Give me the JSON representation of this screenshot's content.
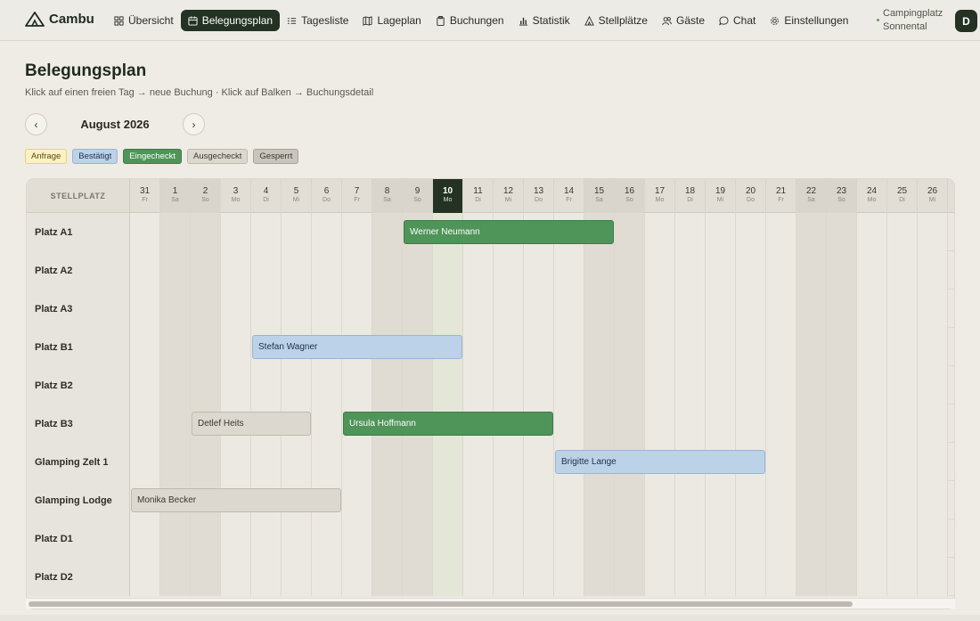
{
  "app": {
    "name": "Cambu",
    "site": "Campingplatz Sonnental",
    "user_initial": "D"
  },
  "nav": [
    {
      "label": "Übersicht",
      "icon": "grid-icon"
    },
    {
      "label": "Belegungsplan",
      "icon": "calendar-icon",
      "active": true
    },
    {
      "label": "Tagesliste",
      "icon": "list-icon"
    },
    {
      "label": "Lageplan",
      "icon": "map-icon"
    },
    {
      "label": "Buchungen",
      "icon": "clipboard-icon"
    },
    {
      "label": "Statistik",
      "icon": "bar-chart-icon"
    },
    {
      "label": "Stellplätze",
      "icon": "tent-icon"
    },
    {
      "label": "Gäste",
      "icon": "users-icon"
    },
    {
      "label": "Chat",
      "icon": "chat-icon"
    },
    {
      "label": "Einstellungen",
      "icon": "gear-icon"
    }
  ],
  "page": {
    "title": "Belegungsplan",
    "subtitle": "Klick auf einen freien Tag → neue Buchung · Klick auf Balken → Buchungsdetail",
    "month": "August 2026",
    "prev": "‹",
    "next": "›"
  },
  "legend": [
    {
      "label": "Anfrage",
      "bg": "#fbf1c4",
      "border": "#e6d27a",
      "color": "#5a4a10"
    },
    {
      "label": "Bestätigt",
      "bg": "#bcd2e9",
      "border": "#9ab4d3",
      "color": "#223248"
    },
    {
      "label": "Eingecheckt",
      "bg": "#4f9458",
      "border": "#3e7c47",
      "color": "#ffffff"
    },
    {
      "label": "Ausgecheckt",
      "bg": "#ddd8cf",
      "border": "#bfb9ad",
      "color": "#3a372f"
    },
    {
      "label": "Gesperrt",
      "bg": "#c9c5bc",
      "border": "#a9a49a",
      "color": "#3a372f"
    }
  ],
  "grid": {
    "first_header": "STELLPLATZ",
    "days": [
      {
        "num": "31",
        "wd": "Fr"
      },
      {
        "num": "1",
        "wd": "Sa",
        "weekend": true
      },
      {
        "num": "2",
        "wd": "So",
        "weekend": true
      },
      {
        "num": "3",
        "wd": "Mo"
      },
      {
        "num": "4",
        "wd": "Di"
      },
      {
        "num": "5",
        "wd": "Mi"
      },
      {
        "num": "6",
        "wd": "Do"
      },
      {
        "num": "7",
        "wd": "Fr"
      },
      {
        "num": "8",
        "wd": "Sa",
        "weekend": true
      },
      {
        "num": "9",
        "wd": "So",
        "weekend": true
      },
      {
        "num": "10",
        "wd": "Mo",
        "today": true
      },
      {
        "num": "11",
        "wd": "Di"
      },
      {
        "num": "12",
        "wd": "Mi"
      },
      {
        "num": "13",
        "wd": "Do"
      },
      {
        "num": "14",
        "wd": "Fr"
      },
      {
        "num": "15",
        "wd": "Sa",
        "weekend": true
      },
      {
        "num": "16",
        "wd": "So",
        "weekend": true
      },
      {
        "num": "17",
        "wd": "Mo"
      },
      {
        "num": "18",
        "wd": "Di"
      },
      {
        "num": "19",
        "wd": "Mi"
      },
      {
        "num": "20",
        "wd": "Do"
      },
      {
        "num": "21",
        "wd": "Fr"
      },
      {
        "num": "22",
        "wd": "Sa",
        "weekend": true
      },
      {
        "num": "23",
        "wd": "So",
        "weekend": true
      },
      {
        "num": "24",
        "wd": "Mo"
      },
      {
        "num": "25",
        "wd": "Di"
      },
      {
        "num": "26",
        "wd": "Mi"
      }
    ],
    "rows": [
      {
        "label": "Platz A1",
        "bookings": [
          {
            "guest": "Werner Neumann",
            "status": "checkedin",
            "start": 9,
            "end": 16
          }
        ]
      },
      {
        "label": "Platz A2",
        "bookings": []
      },
      {
        "label": "Platz A3",
        "bookings": []
      },
      {
        "label": "Platz B1",
        "bookings": [
          {
            "guest": "Stefan Wagner",
            "status": "confirmed",
            "start": 4,
            "end": 11
          }
        ]
      },
      {
        "label": "Platz B2",
        "bookings": []
      },
      {
        "label": "Platz B3",
        "bookings": [
          {
            "guest": "Detlef Heits",
            "status": "checkedout",
            "start": 2,
            "end": 6
          },
          {
            "guest": "Ursula Hoffmann",
            "status": "checkedin",
            "start": 7,
            "end": 14
          }
        ]
      },
      {
        "label": "Glamping Zelt 1",
        "bookings": [
          {
            "guest": "Brigitte Lange",
            "status": "confirmed",
            "start": 14,
            "end": 21
          }
        ]
      },
      {
        "label": "Glamping Lodge",
        "bookings": [
          {
            "guest": "Monika Becker",
            "status": "checkedout",
            "start": 0,
            "end": 7
          }
        ]
      },
      {
        "label": "Platz D1",
        "bookings": []
      },
      {
        "label": "Platz D2",
        "bookings": []
      }
    ]
  }
}
